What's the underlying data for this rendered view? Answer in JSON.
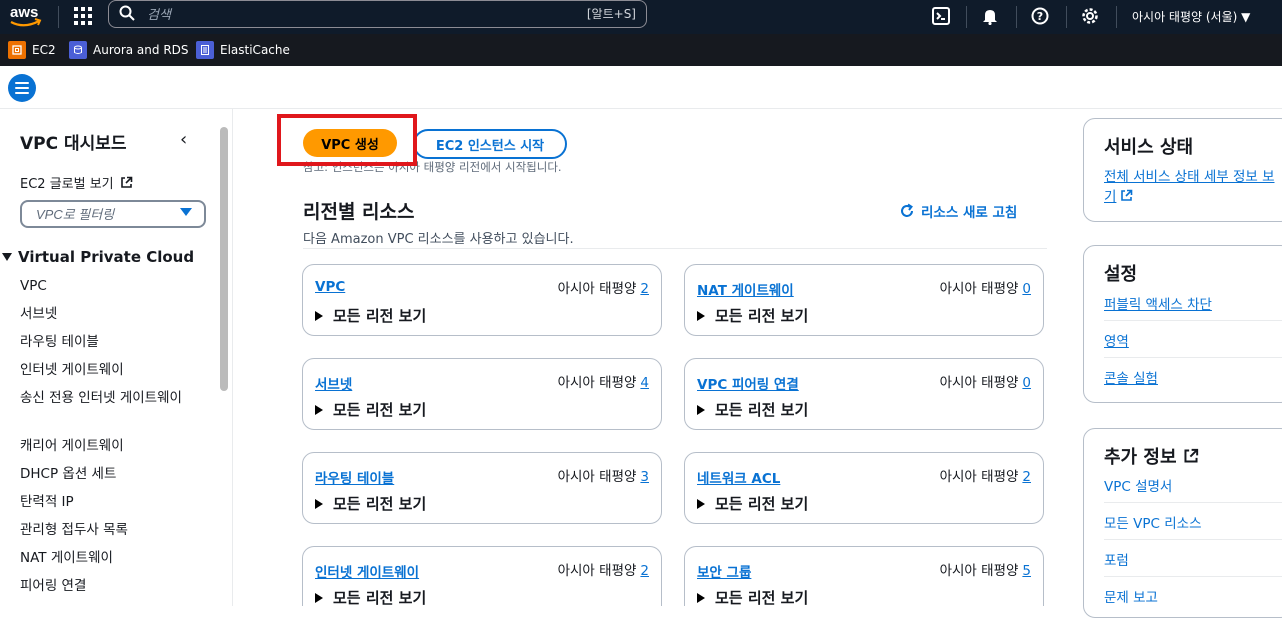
{
  "topnav": {
    "logo_text": "aws",
    "search_placeholder": "검색",
    "search_shortcut": "[알트+S]",
    "region_menu": "아시아 태평양 (서울) ▼"
  },
  "favorites": [
    {
      "label": "EC2",
      "color": "#ed7100"
    },
    {
      "label": "Aurora and RDS",
      "color": "#4b5fd6"
    },
    {
      "label": "ElastiCache",
      "color": "#4b5fd6"
    }
  ],
  "sidebar": {
    "title": "VPC 대시보드",
    "global_view": "EC2 글로벌 보기",
    "filter_placeholder": "VPC로 필터링",
    "section": "Virtual Private Cloud",
    "items": [
      "VPC",
      "서브넷",
      "라우팅 테이블",
      "인터넷 게이트웨이",
      "송신 전용 인터넷 게이트웨이",
      "캐리어 게이트웨이",
      "DHCP 옵션 세트",
      "탄력적 IP",
      "관리형 접두사 목록",
      "NAT 게이트웨이",
      "피어링 연결"
    ]
  },
  "main": {
    "create_vpc": "VPC 생성",
    "launch_ec2": "EC2 인스턴스 시작",
    "note": "참고: 인스턴스는 아시아 태평양 리전에서 시작됩니다.",
    "panel_title": "리전별 리소스",
    "refresh": "리소스 새로 고침",
    "panel_subtitle": "다음 Amazon VPC 리소스를 사용하고 있습니다.",
    "region_label": "아시아 태평양",
    "expand_label": "모든 리전 보기",
    "cards": [
      {
        "name": "VPC",
        "count": "2"
      },
      {
        "name": "NAT 게이트웨이",
        "count": "0"
      },
      {
        "name": "서브넷",
        "count": "4"
      },
      {
        "name": "VPC 피어링 연결",
        "count": "0"
      },
      {
        "name": "라우팅 테이블",
        "count": "3"
      },
      {
        "name": "네트워크 ACL",
        "count": "2"
      },
      {
        "name": "인터넷 게이트웨이",
        "count": "2"
      },
      {
        "name": "보안 그룹",
        "count": "5"
      }
    ]
  },
  "right": {
    "service_status": {
      "title": "서비스 상태",
      "link_line1": "전체 서비스 상태 세부 정보 보",
      "link_line2": "기"
    },
    "settings": {
      "title": "설정",
      "links": [
        "퍼블릭 액세스 차단",
        "영역",
        "콘솔 실험"
      ]
    },
    "more_info": {
      "title": "추가 정보",
      "links": [
        "VPC 설명서",
        "모든 VPC 리소스",
        "포럼",
        "문제 보고"
      ]
    }
  },
  "colors": {
    "primary_button": "#ff9900",
    "link": "#0972d3",
    "nav_bg": "#0f1b2a",
    "highlight_box": "#e0171c"
  }
}
